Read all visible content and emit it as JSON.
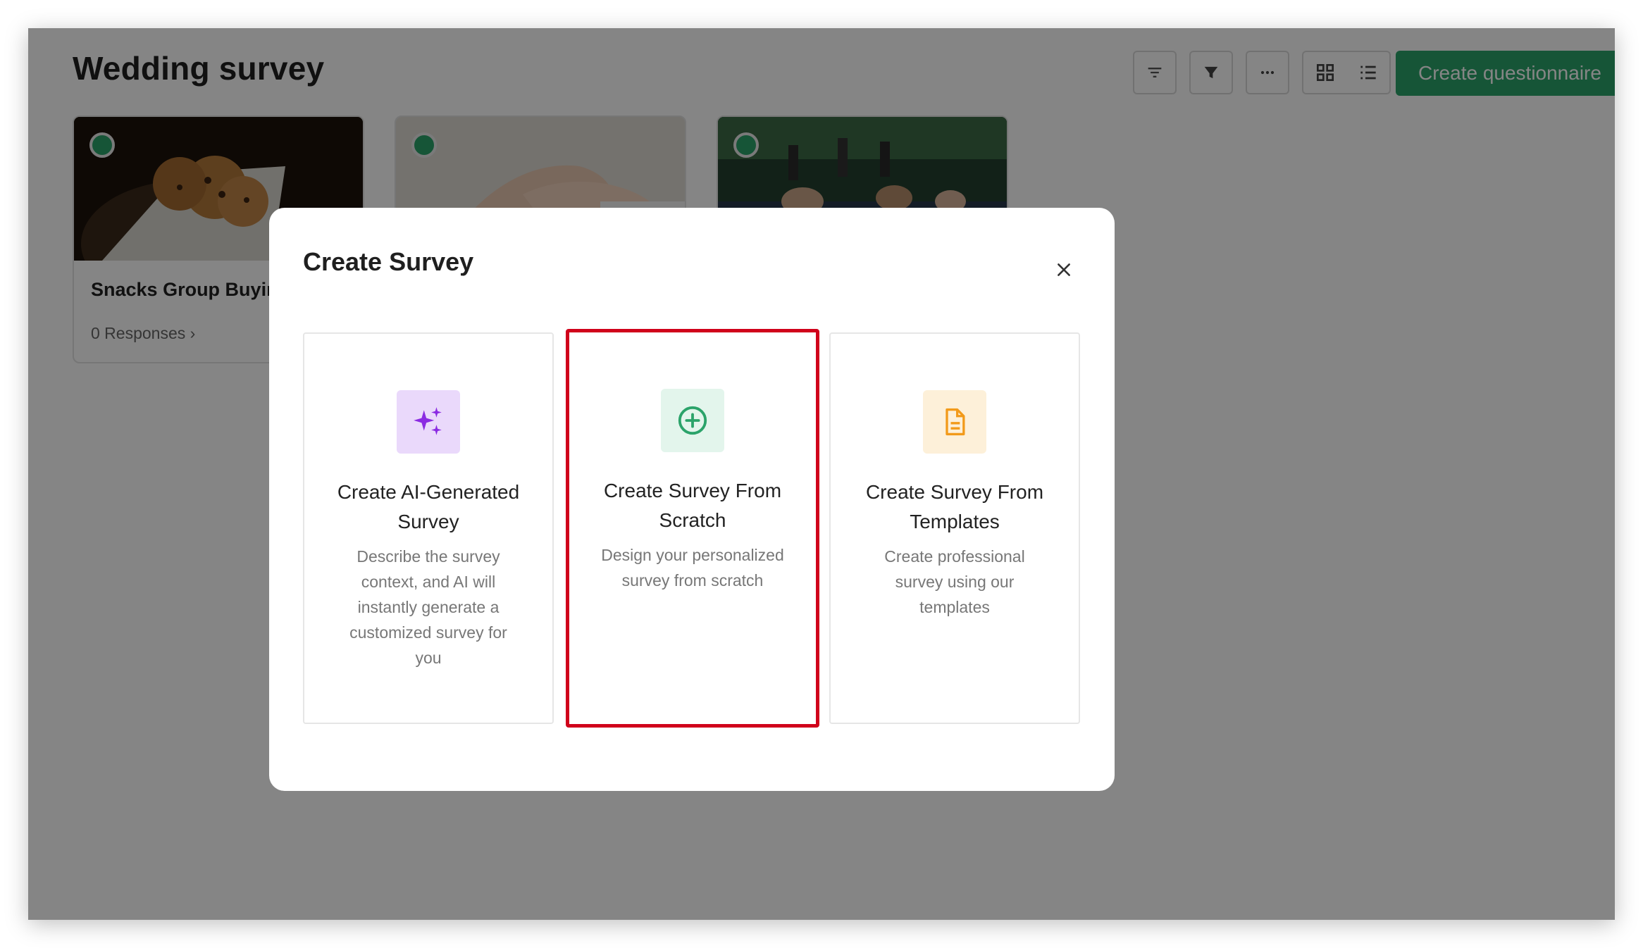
{
  "page": {
    "title": "Wedding survey"
  },
  "toolbar": {
    "create_label": "Create questionnaire"
  },
  "cards": [
    {
      "title": "Snacks Group Buying",
      "responses": "0 Responses"
    },
    {
      "title": "",
      "responses": ""
    },
    {
      "title": "",
      "responses": ""
    }
  ],
  "modal": {
    "title": "Create Survey",
    "options": [
      {
        "title": "Create AI-Generated Survey",
        "description": "Describe the survey context, and AI will instantly generate a customized survey for you",
        "icon": "sparkles-icon",
        "icon_bg": "#ead9fb",
        "icon_color": "#8b2be2"
      },
      {
        "title": "Create Survey From Scratch",
        "description": "Design your personalized survey from scratch",
        "icon": "plus-circle-icon",
        "icon_bg": "#e3f5ec",
        "icon_color": "#2ba36a"
      },
      {
        "title": "Create Survey From Templates",
        "description": "Create professional survey using our templates",
        "icon": "document-icon",
        "icon_bg": "#fdf0d9",
        "icon_color": "#f29a1a"
      }
    ]
  },
  "colors": {
    "accent_green": "#2ba36a",
    "highlight_red": "#d0021b"
  }
}
